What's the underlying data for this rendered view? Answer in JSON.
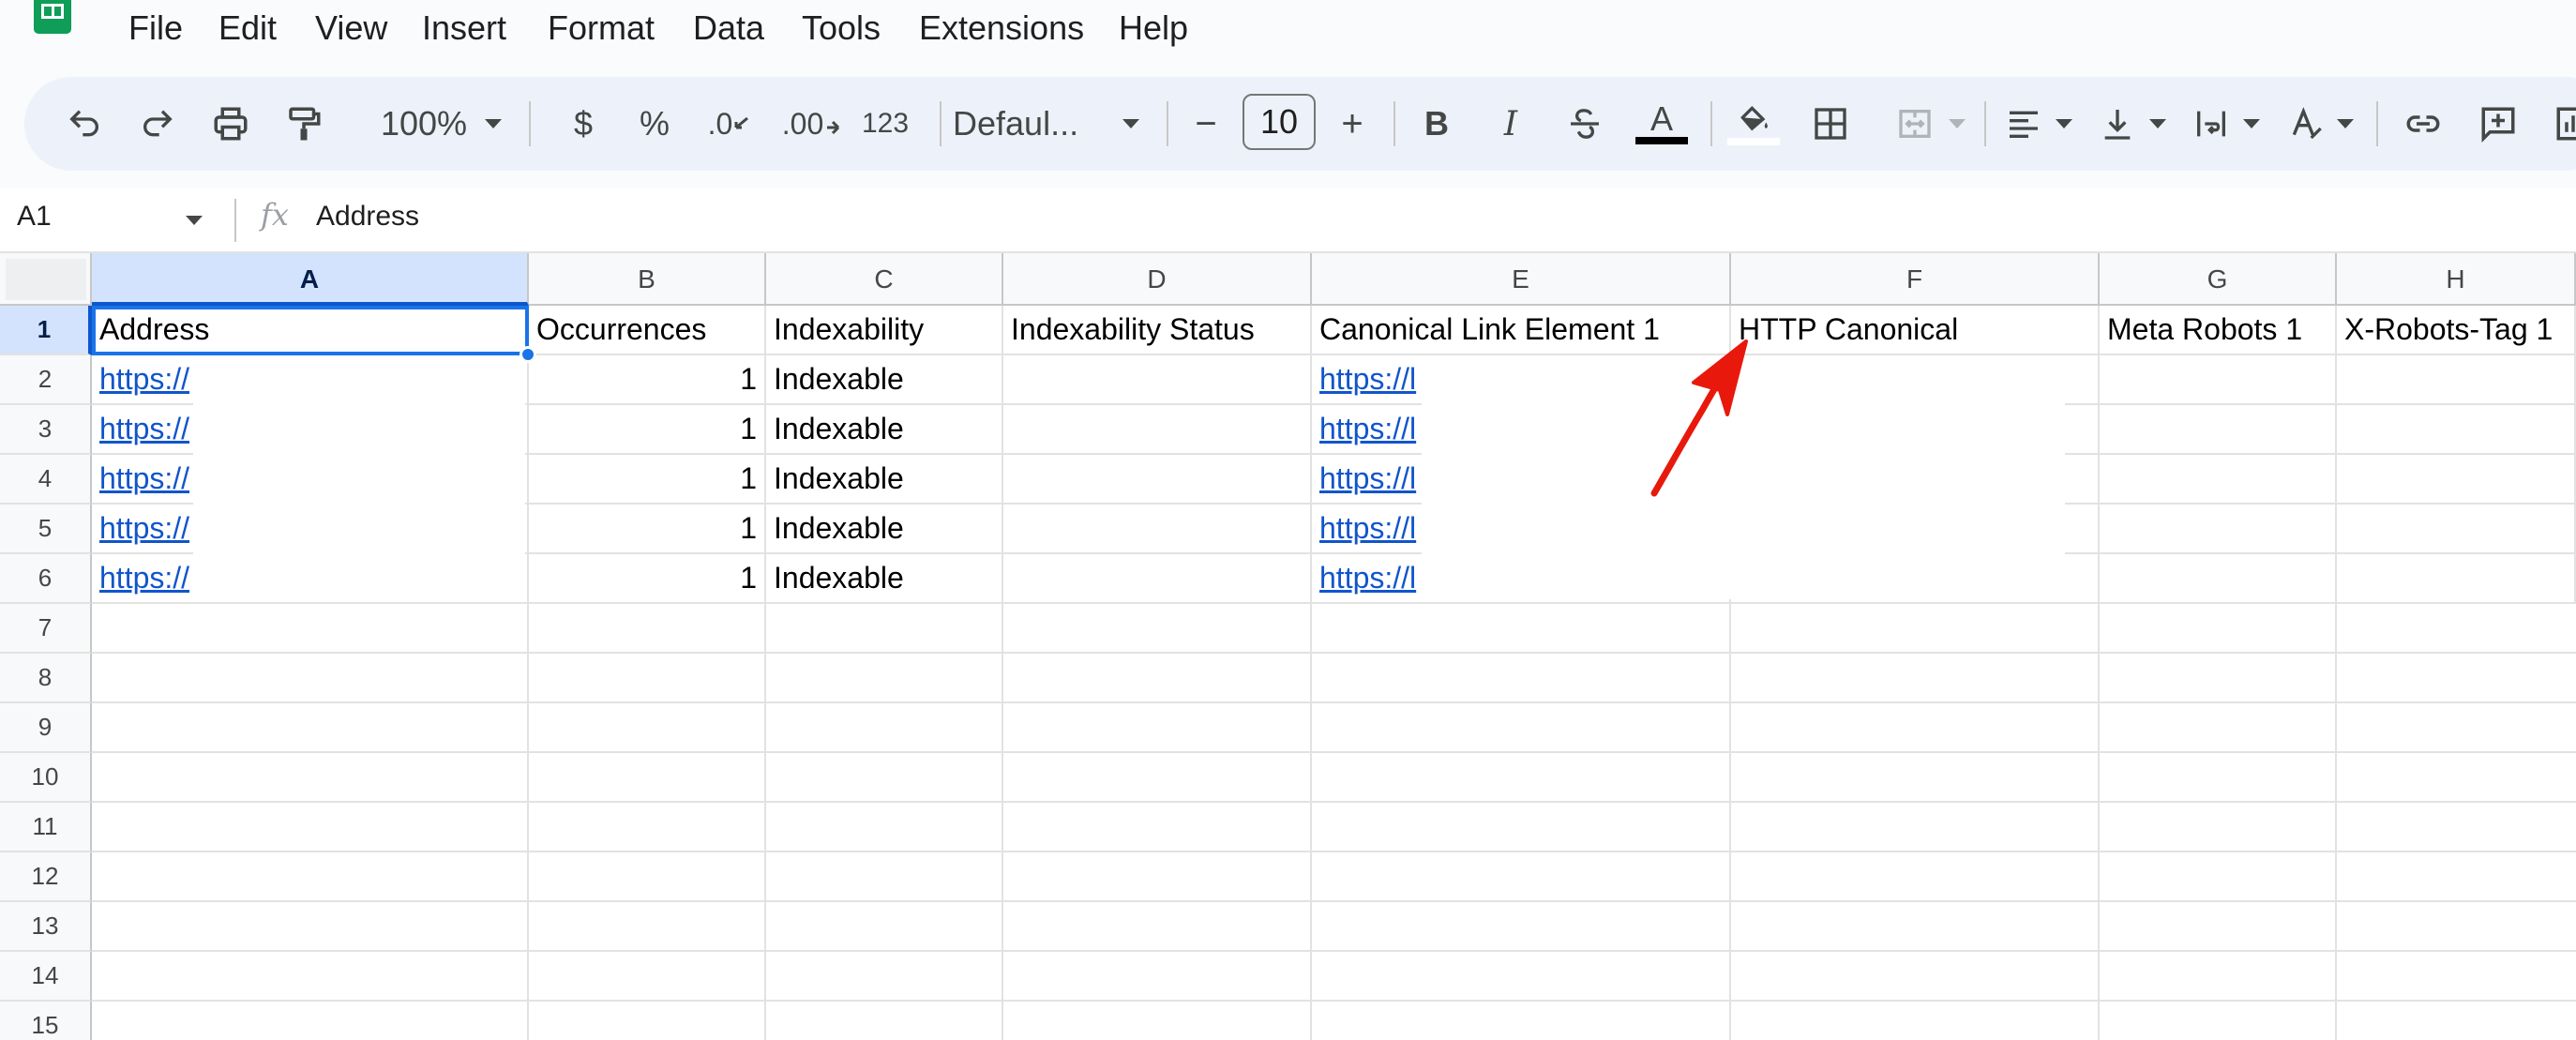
{
  "menu": [
    "File",
    "Edit",
    "View",
    "Insert",
    "Format",
    "Data",
    "Tools",
    "Extensions",
    "Help"
  ],
  "toolbar": {
    "zoom": "100%",
    "currency": "$",
    "percent": "%",
    "dec_decrease": ".0",
    "dec_increase": ".00",
    "format_123": "123",
    "font": "Defaul...",
    "font_size": "10",
    "minus": "−",
    "plus": "+",
    "bold": "B",
    "italic": "I",
    "text_color_letter": "A",
    "text_color": "#000000"
  },
  "formula_bar": {
    "cell_ref": "A1",
    "fx": "fx",
    "content": "Address"
  },
  "columns": [
    "A",
    "B",
    "C",
    "D",
    "E",
    "F",
    "G",
    "H"
  ],
  "rows": [
    "1",
    "2",
    "3",
    "4",
    "5",
    "6",
    "7",
    "8",
    "9",
    "10",
    "11",
    "12",
    "13",
    "14",
    "15"
  ],
  "header_row": [
    "Address",
    "Occurrences",
    "Indexability",
    "Indexability Status",
    "Canonical Link Element 1",
    "HTTP Canonical",
    "Meta Robots 1",
    "X-Robots-Tag 1"
  ],
  "data_rows": [
    {
      "address": "https://",
      "occurrences": "1",
      "indexability": "Indexable",
      "canonical": "https://l"
    },
    {
      "address": "https://",
      "occurrences": "1",
      "indexability": "Indexable",
      "canonical": "https://l"
    },
    {
      "address": "https://",
      "occurrences": "1",
      "indexability": "Indexable",
      "canonical": "https://l"
    },
    {
      "address": "https://",
      "occurrences": "1",
      "indexability": "Indexable",
      "canonical": "https://l"
    },
    {
      "address": "https://",
      "occurrences": "1",
      "indexability": "Indexable",
      "canonical": "https://l"
    }
  ],
  "annotation": {
    "color": "#e8190c",
    "points_to": "HTTP Canonical"
  },
  "colors": {
    "selection": "#1a73e8",
    "header_selected_bg": "#d3e3fd",
    "link": "#1155cc",
    "toolbar_bg": "#edf2fa",
    "sheets_green": "#0f9d58"
  }
}
